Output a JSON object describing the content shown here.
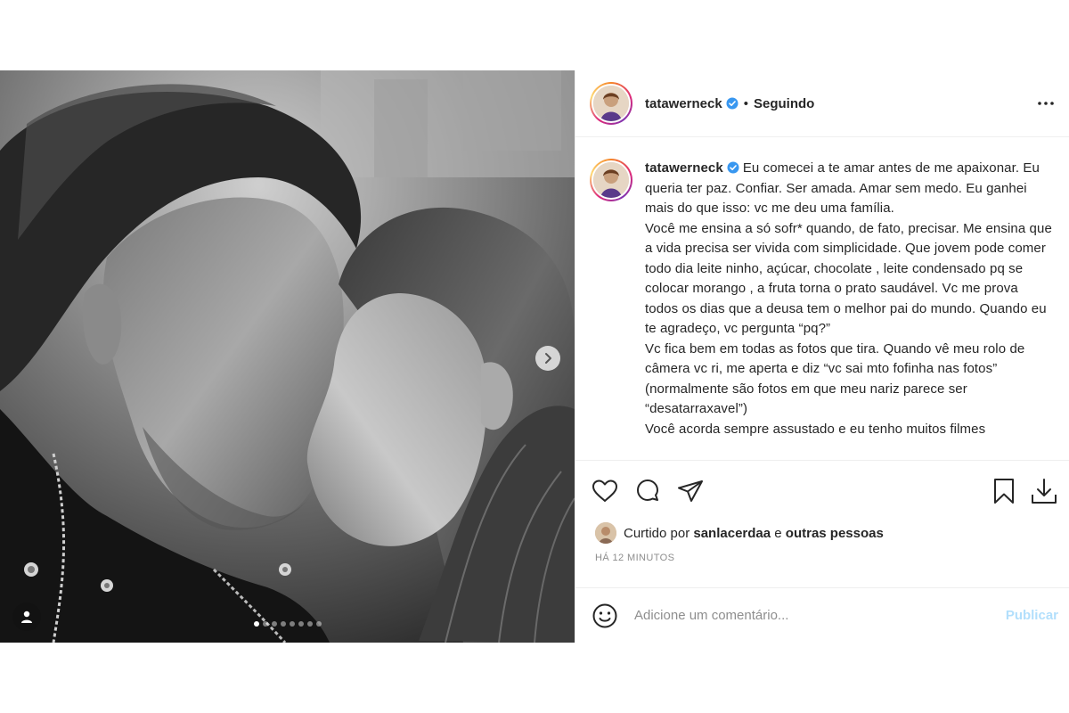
{
  "post": {
    "username": "tatawerneck",
    "follow_state": "Seguindo",
    "separator": "•",
    "caption": "Eu comecei a te amar antes de me apaixonar. Eu queria ter paz. Confiar. Ser amada. Amar sem medo. Eu ganhei mais do que isso: vc me deu uma família.\nVocê me ensina a só sofr* quando, de fato, precisar. Me ensina que a vida precisa ser vivida com simplicidade. Que jovem pode comer todo dia leite ninho, açúcar, chocolate , leite condensado pq se colocar morango , a fruta torna o prato saudável. Vc me prova todos os dias que a deusa tem o melhor pai do mundo. Quando eu te agradeço, vc pergunta “pq?”\nVc fica bem em todas as fotos que tira. Quando vê meu rolo de câmera vc ri, me aperta e diz “vc sai mto fofinha nas fotos” (normalmente são fotos em que meu nariz parece ser “desatarraxavel”)\nVocê acorda sempre assustado e eu tenho muitos filmes",
    "likes": {
      "prefix": "Curtido por",
      "user": "sanlacerdaa",
      "and": "e",
      "others": "outras pessoas"
    },
    "timestamp": "HÁ 12 MINUTOS",
    "carousel": {
      "count": 8,
      "active_index": 0
    }
  },
  "comment_box": {
    "placeholder": "Adicione um comentário...",
    "publish_label": "Publicar"
  },
  "icons": {
    "like": "heart-icon",
    "comment": "comment-icon",
    "share": "send-icon",
    "save": "bookmark-icon",
    "download": "download-icon",
    "more": "more-icon",
    "emoji": "emoji-icon",
    "verified": "verified-badge-icon",
    "next": "chevron-right-icon",
    "tag": "user-tag-icon"
  },
  "colors": {
    "verified": "#3897f0",
    "publish_disabled": "#b2dffc",
    "muted": "#8e8e8e"
  }
}
